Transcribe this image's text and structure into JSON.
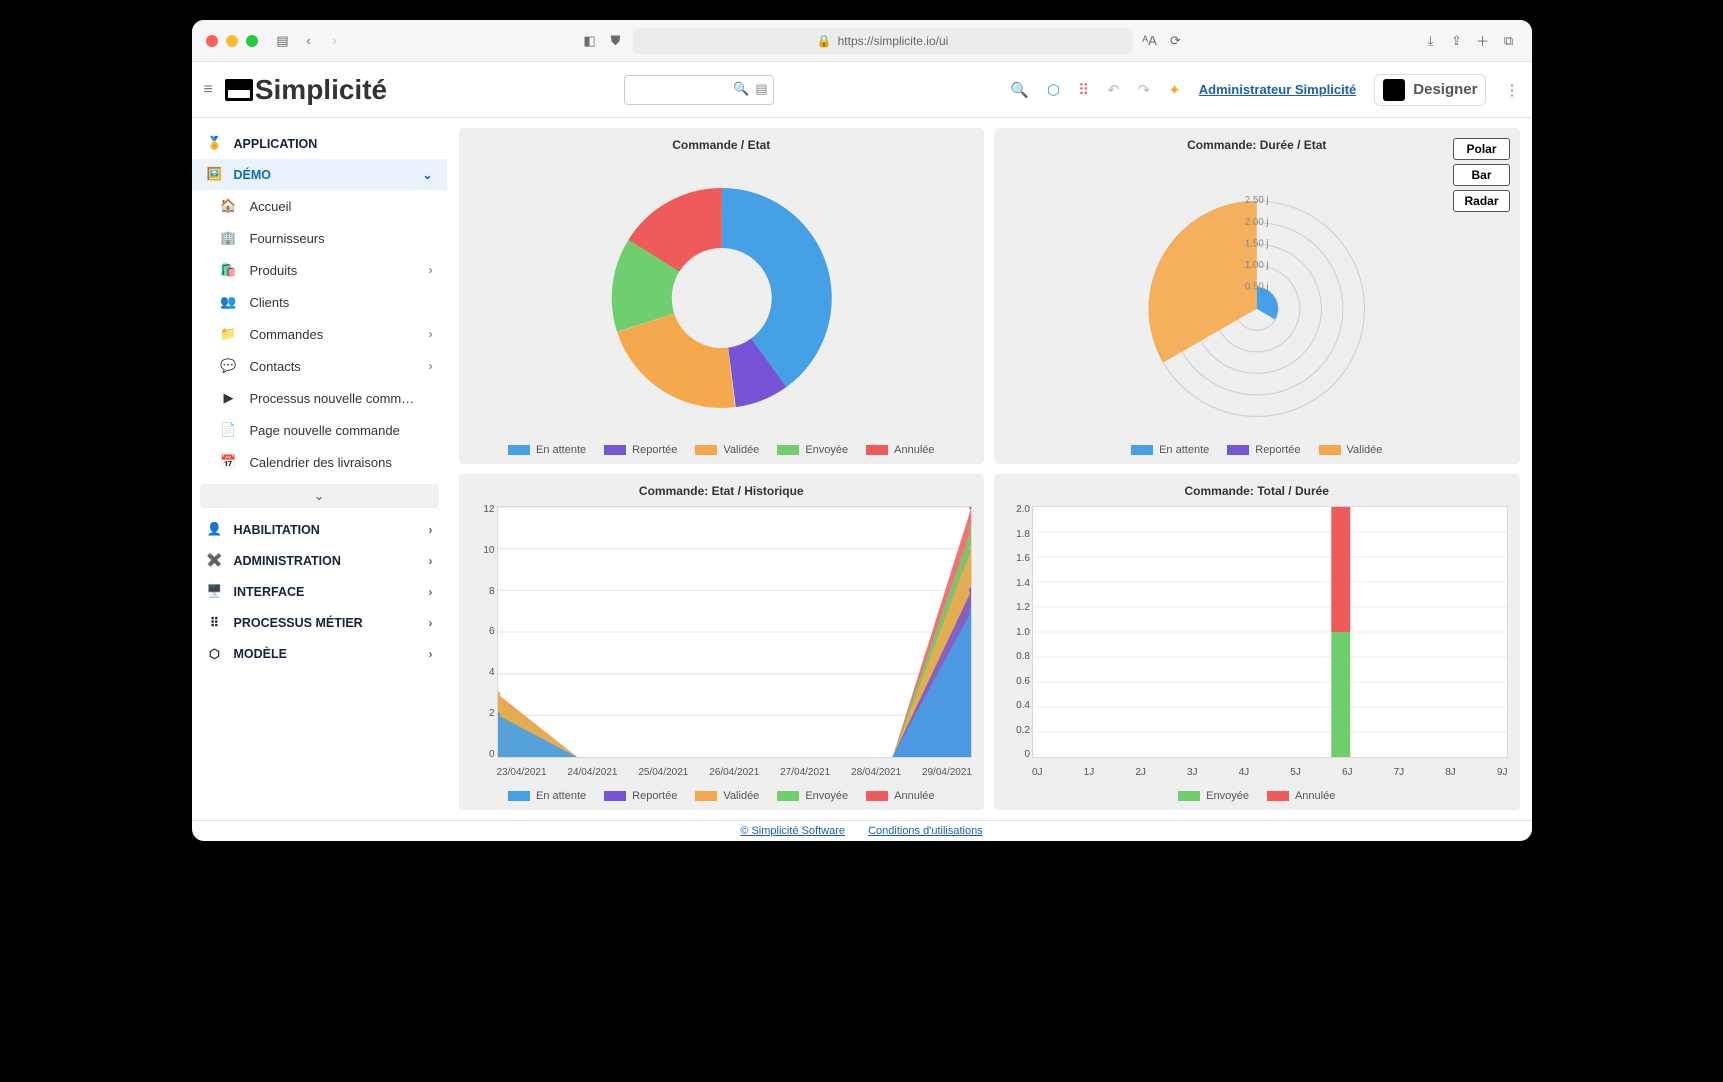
{
  "browser": {
    "url": "https://simplicite.io/ui"
  },
  "header": {
    "brand": "Simplicité",
    "admin_link": "Administrateur Simplicité",
    "designer_label": "Designer"
  },
  "sidebar": {
    "sections": [
      {
        "label": "APPLICATION",
        "expandable": false
      },
      {
        "label": "DÉMO",
        "active": true,
        "expandable": true,
        "open": true
      },
      {
        "label": "HABILITATION",
        "expandable": true
      },
      {
        "label": "ADMINISTRATION",
        "expandable": true
      },
      {
        "label": "INTERFACE",
        "expandable": true
      },
      {
        "label": "PROCESSUS MÉTIER",
        "expandable": true
      },
      {
        "label": "MODÈLE",
        "expandable": true
      }
    ],
    "demo_items": [
      {
        "label": "Accueil",
        "icon": "🏠"
      },
      {
        "label": "Fournisseurs",
        "icon": "🏢"
      },
      {
        "label": "Produits",
        "icon": "🛍️",
        "chev": true
      },
      {
        "label": "Clients",
        "icon": "👥"
      },
      {
        "label": "Commandes",
        "icon": "📁",
        "chev": true
      },
      {
        "label": "Contacts",
        "icon": "💬",
        "chev": true
      },
      {
        "label": "Processus nouvelle comm…",
        "icon": "▶"
      },
      {
        "label": "Page nouvelle commande",
        "icon": "📄"
      },
      {
        "label": "Calendrier des livraisons",
        "icon": "📅"
      }
    ]
  },
  "colors": {
    "attente": "#46a0e6",
    "reportee": "#7754d6",
    "validee": "#f5a94c",
    "envoyee": "#6fcf6f",
    "annulee": "#ef5b5b"
  },
  "charts": {
    "etat": {
      "title": "Commande / Etat",
      "legend": [
        "En attente",
        "Reportée",
        "Validée",
        "Envoyée",
        "Annulée"
      ]
    },
    "duree": {
      "title": "Commande: Durée / Etat",
      "ticks": [
        "2.50 j",
        "2.00 j",
        "1.50 j",
        "1.00 j",
        "0.50 j"
      ],
      "buttons": {
        "polar": "Polar",
        "bar": "Bar",
        "radar": "Radar"
      },
      "legend": [
        "En attente",
        "Reportée",
        "Validée"
      ]
    },
    "historique": {
      "title": "Commande: Etat / Historique",
      "y": [
        "12",
        "10",
        "8",
        "6",
        "4",
        "2",
        "0"
      ],
      "x": [
        "23/04/2021",
        "24/04/2021",
        "25/04/2021",
        "26/04/2021",
        "27/04/2021",
        "28/04/2021",
        "29/04/2021"
      ],
      "legend": [
        "En attente",
        "Reportée",
        "Validée",
        "Envoyée",
        "Annulée"
      ]
    },
    "total": {
      "title": "Commande: Total / Durée",
      "y": [
        "2.0",
        "1.8",
        "1.6",
        "1.4",
        "1.2",
        "1.0",
        "0.8",
        "0.6",
        "0.4",
        "0.2",
        "0"
      ],
      "x": [
        "0J",
        "1J",
        "2J",
        "3J",
        "4J",
        "5J",
        "6J",
        "7J",
        "8J",
        "9J"
      ],
      "legend": [
        "Envoyée",
        "Annulée"
      ]
    }
  },
  "footer": {
    "company": "© Simplicité Software",
    "terms": "Conditions d'utilisations"
  },
  "chart_data": [
    {
      "type": "pie",
      "title": "Commande / Etat",
      "series": [
        {
          "name": "En attente",
          "value": 40
        },
        {
          "name": "Reportée",
          "value": 8
        },
        {
          "name": "Validée",
          "value": 22
        },
        {
          "name": "Envoyée",
          "value": 14
        },
        {
          "name": "Annulée",
          "value": 16
        }
      ]
    },
    {
      "type": "area",
      "title": "Commande: Durée / Etat (polar)",
      "categories": [
        "En attente",
        "Reportée",
        "Validée"
      ],
      "values": [
        0.5,
        0.0,
        2.5
      ],
      "ylim": [
        0,
        2.5
      ]
    },
    {
      "type": "area",
      "title": "Commande: Etat / Historique",
      "x": [
        "23/04/2021",
        "24/04/2021",
        "25/04/2021",
        "26/04/2021",
        "27/04/2021",
        "28/04/2021",
        "29/04/2021"
      ],
      "series": [
        {
          "name": "En attente",
          "values": [
            2,
            0,
            0,
            0,
            0,
            0,
            7
          ]
        },
        {
          "name": "Reportée",
          "values": [
            0,
            0,
            0,
            0,
            0,
            0,
            8
          ]
        },
        {
          "name": "Validée",
          "values": [
            3,
            0,
            0,
            0,
            0,
            0,
            10
          ]
        },
        {
          "name": "Envoyée",
          "values": [
            0,
            0,
            0,
            0,
            0,
            0,
            11
          ]
        },
        {
          "name": "Annulée",
          "values": [
            0,
            0,
            0,
            0,
            0,
            0,
            12
          ]
        }
      ],
      "ylim": [
        0,
        12
      ]
    },
    {
      "type": "bar",
      "title": "Commande: Total / Durée",
      "categories": [
        "0J",
        "1J",
        "2J",
        "3J",
        "4J",
        "5J",
        "6J",
        "7J",
        "8J",
        "9J"
      ],
      "series": [
        {
          "name": "Envoyée",
          "values": [
            0,
            0,
            0,
            0,
            0,
            0,
            1,
            0,
            0,
            0
          ]
        },
        {
          "name": "Annulée",
          "values": [
            0,
            0,
            0,
            0,
            0,
            0,
            1,
            0,
            0,
            0
          ]
        }
      ],
      "ylim": [
        0,
        2.0
      ]
    }
  ]
}
